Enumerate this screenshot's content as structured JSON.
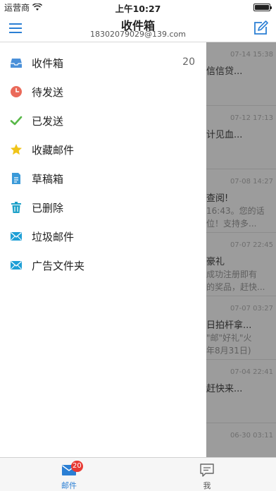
{
  "status_bar": {
    "carrier": "运营商",
    "time": "上午10:27"
  },
  "header": {
    "title": "收件箱",
    "account_email": "18302079029@139.com"
  },
  "drawer": {
    "items": [
      {
        "label": "收件箱",
        "count": "20",
        "icon": "inbox-icon"
      },
      {
        "label": "待发送",
        "icon": "clock-icon"
      },
      {
        "label": "已发送",
        "icon": "checkmark-icon"
      },
      {
        "label": "收藏邮件",
        "icon": "star-icon"
      },
      {
        "label": "草稿箱",
        "icon": "draft-document-icon"
      },
      {
        "label": "已删除",
        "icon": "trash-icon"
      },
      {
        "label": "垃圾邮件",
        "icon": "envelope-icon"
      },
      {
        "label": "广告文件夹",
        "icon": "envelope-icon"
      }
    ]
  },
  "background_mails": [
    {
      "date": "07-14 15:38",
      "subject": "信信贷...",
      "preview": ""
    },
    {
      "date": "07-12 17:13",
      "subject": "计见血...",
      "preview": ""
    },
    {
      "date": "07-08 14:27",
      "subject": "查阅!",
      "preview": "16:43。您的话\n位！支持多..."
    },
    {
      "date": "07-07 22:45",
      "subject": "豪礼",
      "preview": "成功注册即有\n的奖品，赶快..."
    },
    {
      "date": "07-07 03:27",
      "subject": "日拍杆拿...",
      "preview": "\"邮\"好礼\"火\n年8月31日)"
    },
    {
      "date": "07-04 22:41",
      "subject": "赶快来...",
      "preview": ""
    },
    {
      "date": "06-30 03:11",
      "subject": "",
      "preview": ""
    }
  ],
  "tab_bar": {
    "mail_label": "邮件",
    "mail_badge": "20",
    "me_label": "我"
  },
  "colors": {
    "accent": "#2b7fd4",
    "badge": "#e83b34",
    "overlay": "#9c9c9c"
  }
}
